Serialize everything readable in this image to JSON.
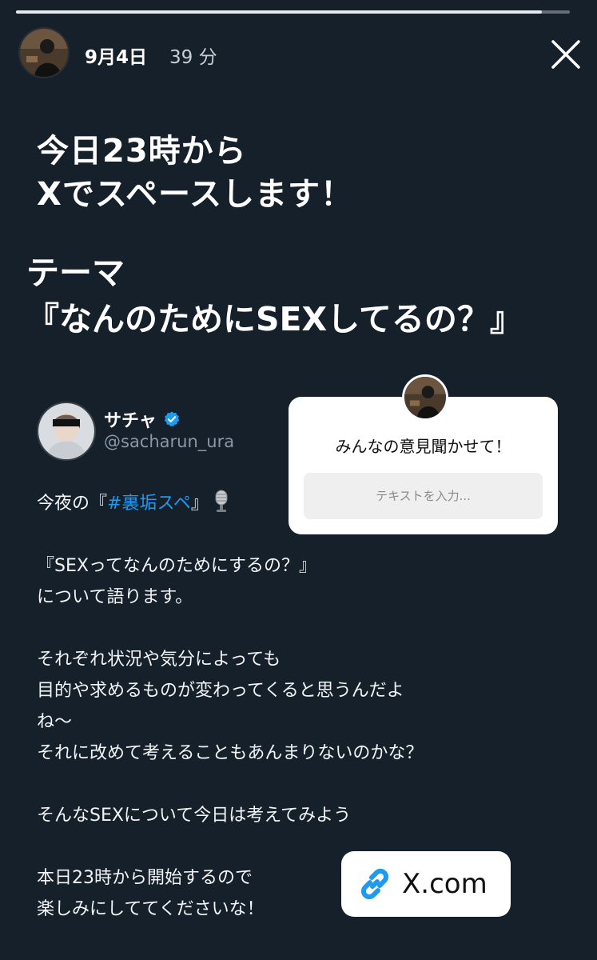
{
  "story": {
    "progress": 0.95,
    "date": "9月4日",
    "elapsed": "39 分"
  },
  "headline": {
    "line1": "今日23時から",
    "line2": "Xでスペースします！"
  },
  "theme": {
    "label": "テーマ",
    "title": "『なんのためにSEXしてるの？』"
  },
  "tweet": {
    "name": "サチャ",
    "handle": "@sacharun_ura",
    "line1_prefix": "今夜の『",
    "hashtag": "#裏垢スペ",
    "line1_suffix": "』",
    "line2": "『SEXってなんのためにするの？』",
    "line3": "について語ります。",
    "line4": "それぞれ状況や気分によっても",
    "line5": "目的や求めるものが変わってくると思うんだよ",
    "line6": "ね〜",
    "line7": "それに改めて考えることもあんまりないのかな？",
    "line8": "そんなSEXについて今日は考えてみよう",
    "line9": "本日23時から開始するので",
    "line10": "楽しみにしててくださいな！"
  },
  "question_sticker": {
    "prompt": "みんなの意見聞かせて！",
    "placeholder": "テキストを入力..."
  },
  "link_sticker": {
    "label": "X.com",
    "icon": "link-icon"
  },
  "colors": {
    "background": "#16202b",
    "hashtag": "#1d9bf0",
    "verified": "#1d9bf0",
    "link_icon": "#1d9bf0"
  }
}
